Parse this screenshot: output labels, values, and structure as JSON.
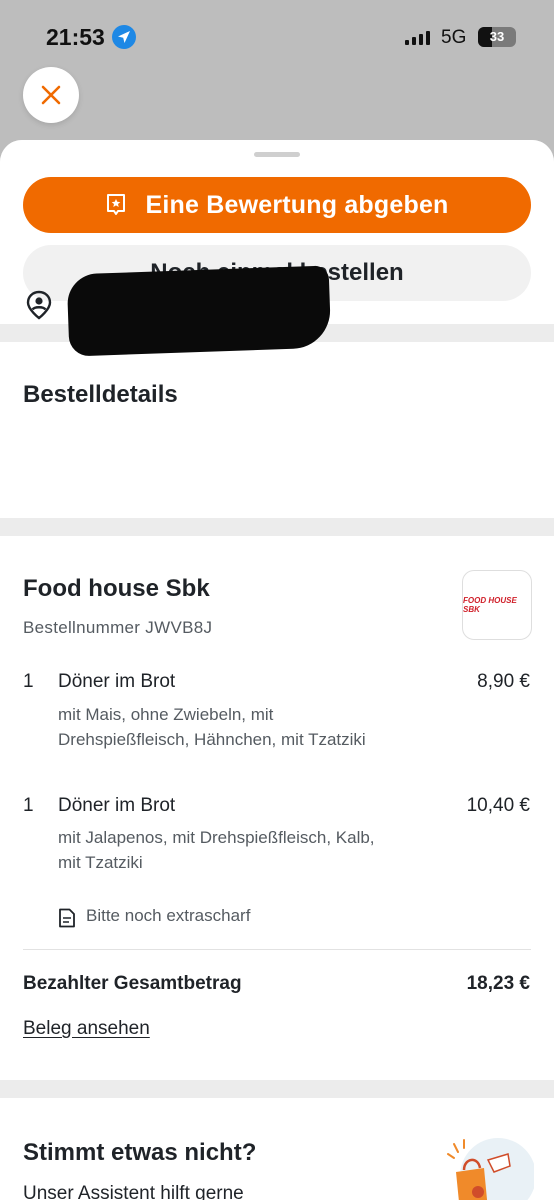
{
  "status_bar": {
    "time": "21:53",
    "network": "5G",
    "battery": "33"
  },
  "actions": {
    "rate_label": "Eine Bewertung abgeben",
    "reorder_label": "Noch einmal bestellen"
  },
  "details": {
    "title": "Bestelldetails"
  },
  "order": {
    "restaurant_name": "Food house Sbk",
    "logo_text": "FOOD HOUSE SBK",
    "order_number": "Bestellnummer JWVB8J",
    "items": [
      {
        "qty": "1",
        "name": "Döner im Brot",
        "price": "8,90 €",
        "mods": "mit Mais, ohne Zwiebeln, mit Drehspießfleisch, Hähnchen, mit Tzatziki"
      },
      {
        "qty": "1",
        "name": "Döner im Brot",
        "price": "10,40 €",
        "mods": "mit Jalapenos, mit Drehspießfleisch, Kalb, mit Tzatziki",
        "note": "Bitte noch extrascharf"
      }
    ],
    "total_label": "Bezahlter Gesamtbetrag",
    "total_value": "18,23 €",
    "receipt_link": "Beleg ansehen"
  },
  "help": {
    "title": "Stimmt etwas nicht?",
    "subtitle": "Unser Assistent hilft gerne"
  },
  "colors": {
    "accent": "#f06a00",
    "background_dim": "#bdbdbd"
  },
  "icons": [
    "location-arrow-icon",
    "signal-icon",
    "battery-icon",
    "close-icon",
    "review-badge-icon",
    "location-pin-icon",
    "note-icon",
    "help-illustration"
  ]
}
